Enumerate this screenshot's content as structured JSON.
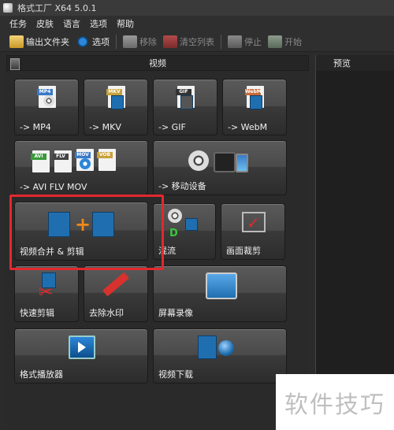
{
  "window": {
    "title": "格式工厂 X64 5.0.1"
  },
  "menu": [
    "任务",
    "皮肤",
    "语言",
    "选项",
    "帮助"
  ],
  "toolbar": {
    "output_folder": "输出文件夹",
    "options": "选项",
    "remove": "移除",
    "clear_list": "清空列表",
    "stop": "停止",
    "start": "开始"
  },
  "panel": {
    "title": "视频"
  },
  "preview": {
    "title": "预览"
  },
  "tiles": {
    "mp4": "-> MP4",
    "mkv": "-> MKV",
    "gif": "-> GIF",
    "webm": "-> WebM",
    "avi_flv_mov": "-> AVI FLV MOV",
    "mobile": "-> 移动设备",
    "merge": "视频合并 & 剪辑",
    "mix": "混流",
    "crop": "画面裁剪",
    "quick_cut": "快速剪辑",
    "remove_watermark": "去除水印",
    "screen_record": "屏幕录像",
    "player": "格式播放器",
    "download": "视频下载"
  },
  "file_tags": {
    "mp4": "MP4",
    "mkv": "MKV",
    "gif": "GIF",
    "webm": "WebM",
    "avi": "AVI",
    "flv": "FLV",
    "mov": "MOV",
    "vob": "VOB"
  },
  "watermark": "软件技巧",
  "colors": {
    "highlight": "#e3282e",
    "accent_blue": "#1f6fb0"
  }
}
